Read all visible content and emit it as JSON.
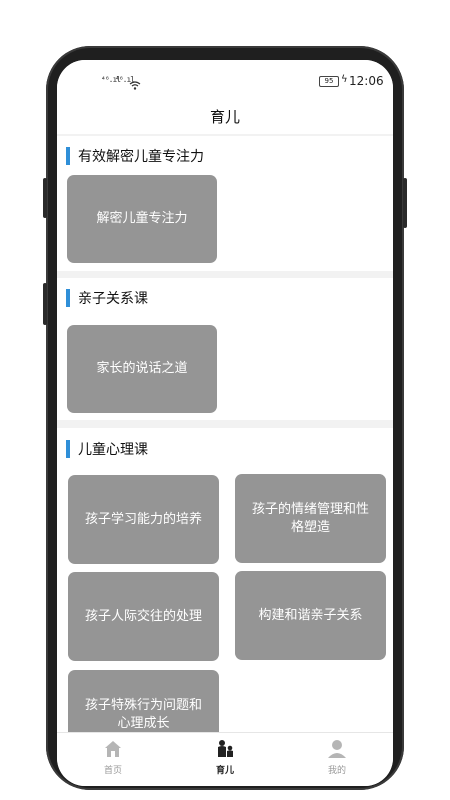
{
  "status_bar": {
    "signal_1": "⁴⁶.ıl",
    "signal_2": "⁴⁶.ıl",
    "battery": "95",
    "time": "12:06"
  },
  "header": {
    "title": "育儿"
  },
  "sections": [
    {
      "title": "有效解密儿童专注力",
      "cards": [
        "解密儿童专注力"
      ]
    },
    {
      "title": "亲子关系课",
      "cards": [
        "家长的说话之道"
      ]
    },
    {
      "title": "儿童心理课",
      "cards": [
        "孩子学习能力的培养",
        "孩子的情绪管理和性格塑造",
        "孩子人际交往的处理",
        "构建和谐亲子关系",
        "孩子特殊行为问题和心理成长"
      ]
    }
  ],
  "tabbar": {
    "items": [
      {
        "label": "首页",
        "icon": "home-icon"
      },
      {
        "label": "育儿",
        "icon": "parenting-icon"
      },
      {
        "label": "我的",
        "icon": "profile-icon"
      }
    ],
    "active_index": 1
  },
  "colors": {
    "accent_bar": "#2f8fd8",
    "card_bg": "#959595"
  }
}
